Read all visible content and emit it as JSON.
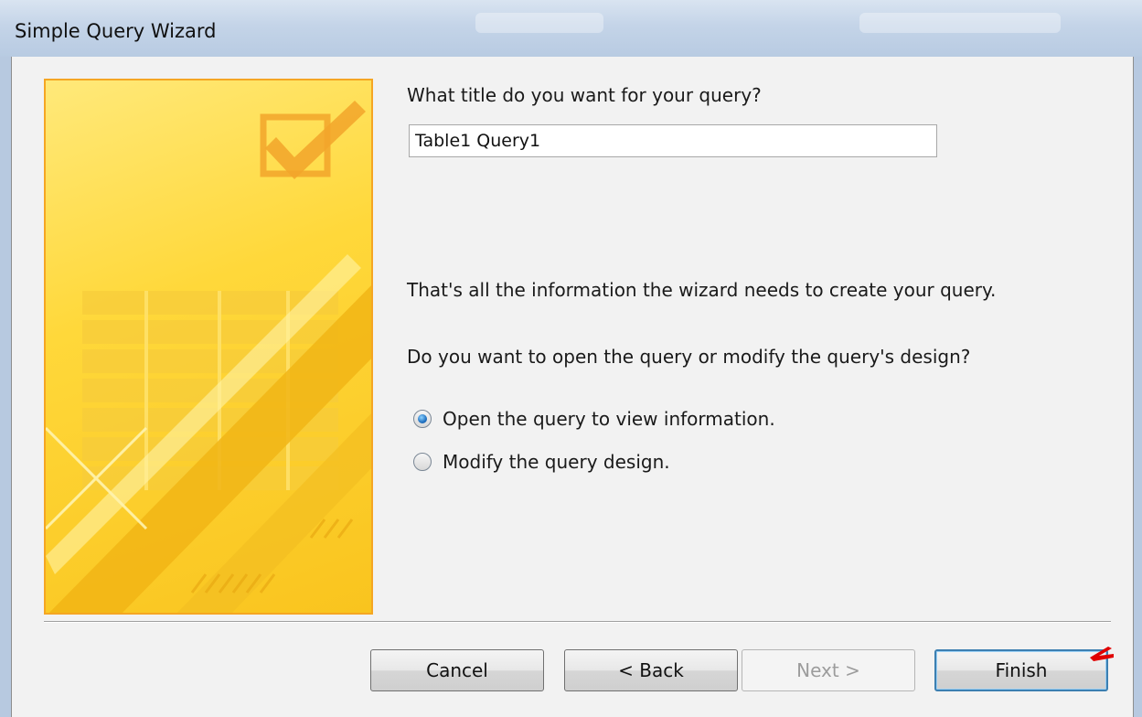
{
  "window": {
    "title": "Simple Query Wizard"
  },
  "form": {
    "prompt": "What title do you want for your query?",
    "title_value": "Table1 Query1",
    "info": "That's all the information the wizard needs to create your query.",
    "question": "Do you want to open the query or modify the query's design?"
  },
  "options": [
    {
      "label": "Open the query to view information.",
      "checked": true
    },
    {
      "label": "Modify the query design.",
      "checked": false
    }
  ],
  "buttons": {
    "cancel": "Cancel",
    "back": "< Back",
    "next": "Next >",
    "finish": "Finish"
  },
  "colors": {
    "banner_border": "#f5a623",
    "banner_yellow": "#ffd83a",
    "radio_selected": "#1f70c1",
    "default_button_border": "#3c7fb1"
  }
}
